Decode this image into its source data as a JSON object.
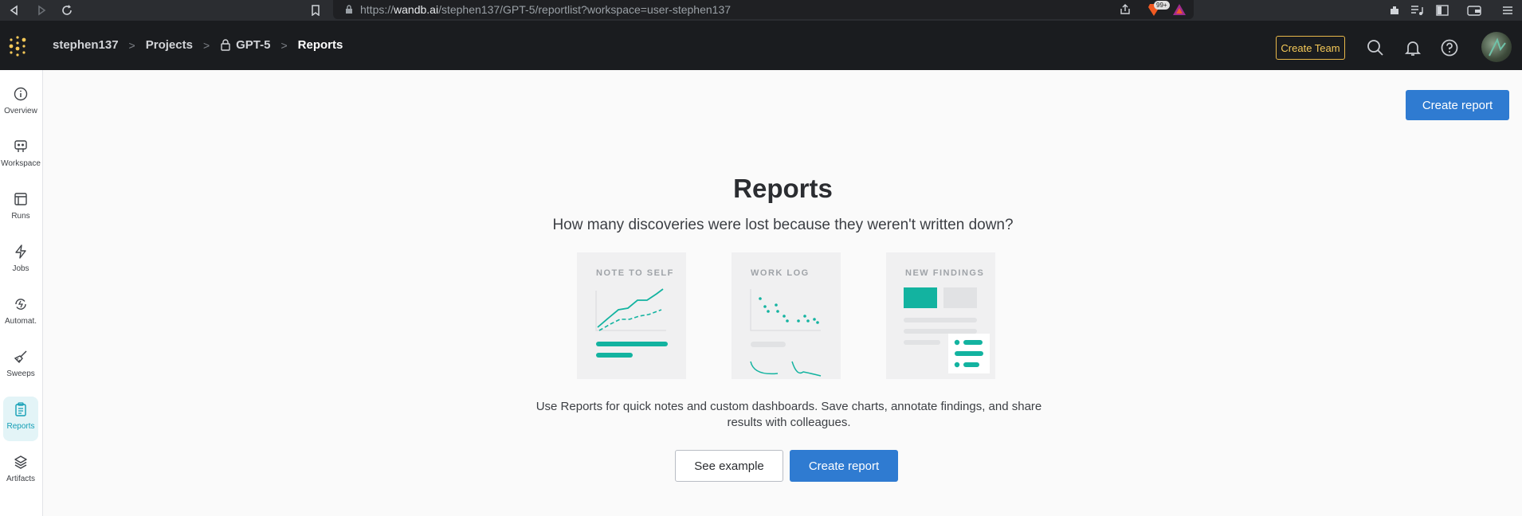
{
  "browser": {
    "url_prefix": "https://",
    "url_domain": "wandb.ai",
    "url_path": "/stephen137/GPT-5/reportlist?workspace=user-stephen137",
    "badge_count": "99+"
  },
  "header": {
    "breadcrumbs": [
      {
        "label": "stephen137"
      },
      {
        "label": "Projects"
      },
      {
        "label": "GPT-5"
      },
      {
        "label": "Reports"
      }
    ],
    "create_team_label": "Create Team"
  },
  "sidebar": {
    "items": [
      {
        "label": "Overview",
        "icon": "info-icon"
      },
      {
        "label": "Workspace",
        "icon": "workspace-icon"
      },
      {
        "label": "Runs",
        "icon": "table-icon"
      },
      {
        "label": "Jobs",
        "icon": "lightning-icon"
      },
      {
        "label": "Automat.",
        "icon": "automation-icon"
      },
      {
        "label": "Sweeps",
        "icon": "broom-icon"
      },
      {
        "label": "Reports",
        "icon": "clipboard-icon",
        "active": true
      },
      {
        "label": "Artifacts",
        "icon": "layers-icon"
      }
    ]
  },
  "main": {
    "top_create_label": "Create report",
    "title": "Reports",
    "subtitle": "How many discoveries were lost because they weren't written down?",
    "cards": [
      {
        "label": "NOTE TO SELF"
      },
      {
        "label": "WORK LOG"
      },
      {
        "label": "NEW FINDINGS"
      }
    ],
    "description_line1": "Use Reports for quick notes and custom dashboards. Save charts, annotate findings, and share",
    "description_line2": "results with colleagues.",
    "see_example_label": "See example",
    "create_report_label": "Create report"
  },
  "colors": {
    "accent_teal": "#13b3a0",
    "primary_blue": "#2f7bd1",
    "create_team_gold": "#f5c958",
    "active_nav": "#139eb5"
  }
}
